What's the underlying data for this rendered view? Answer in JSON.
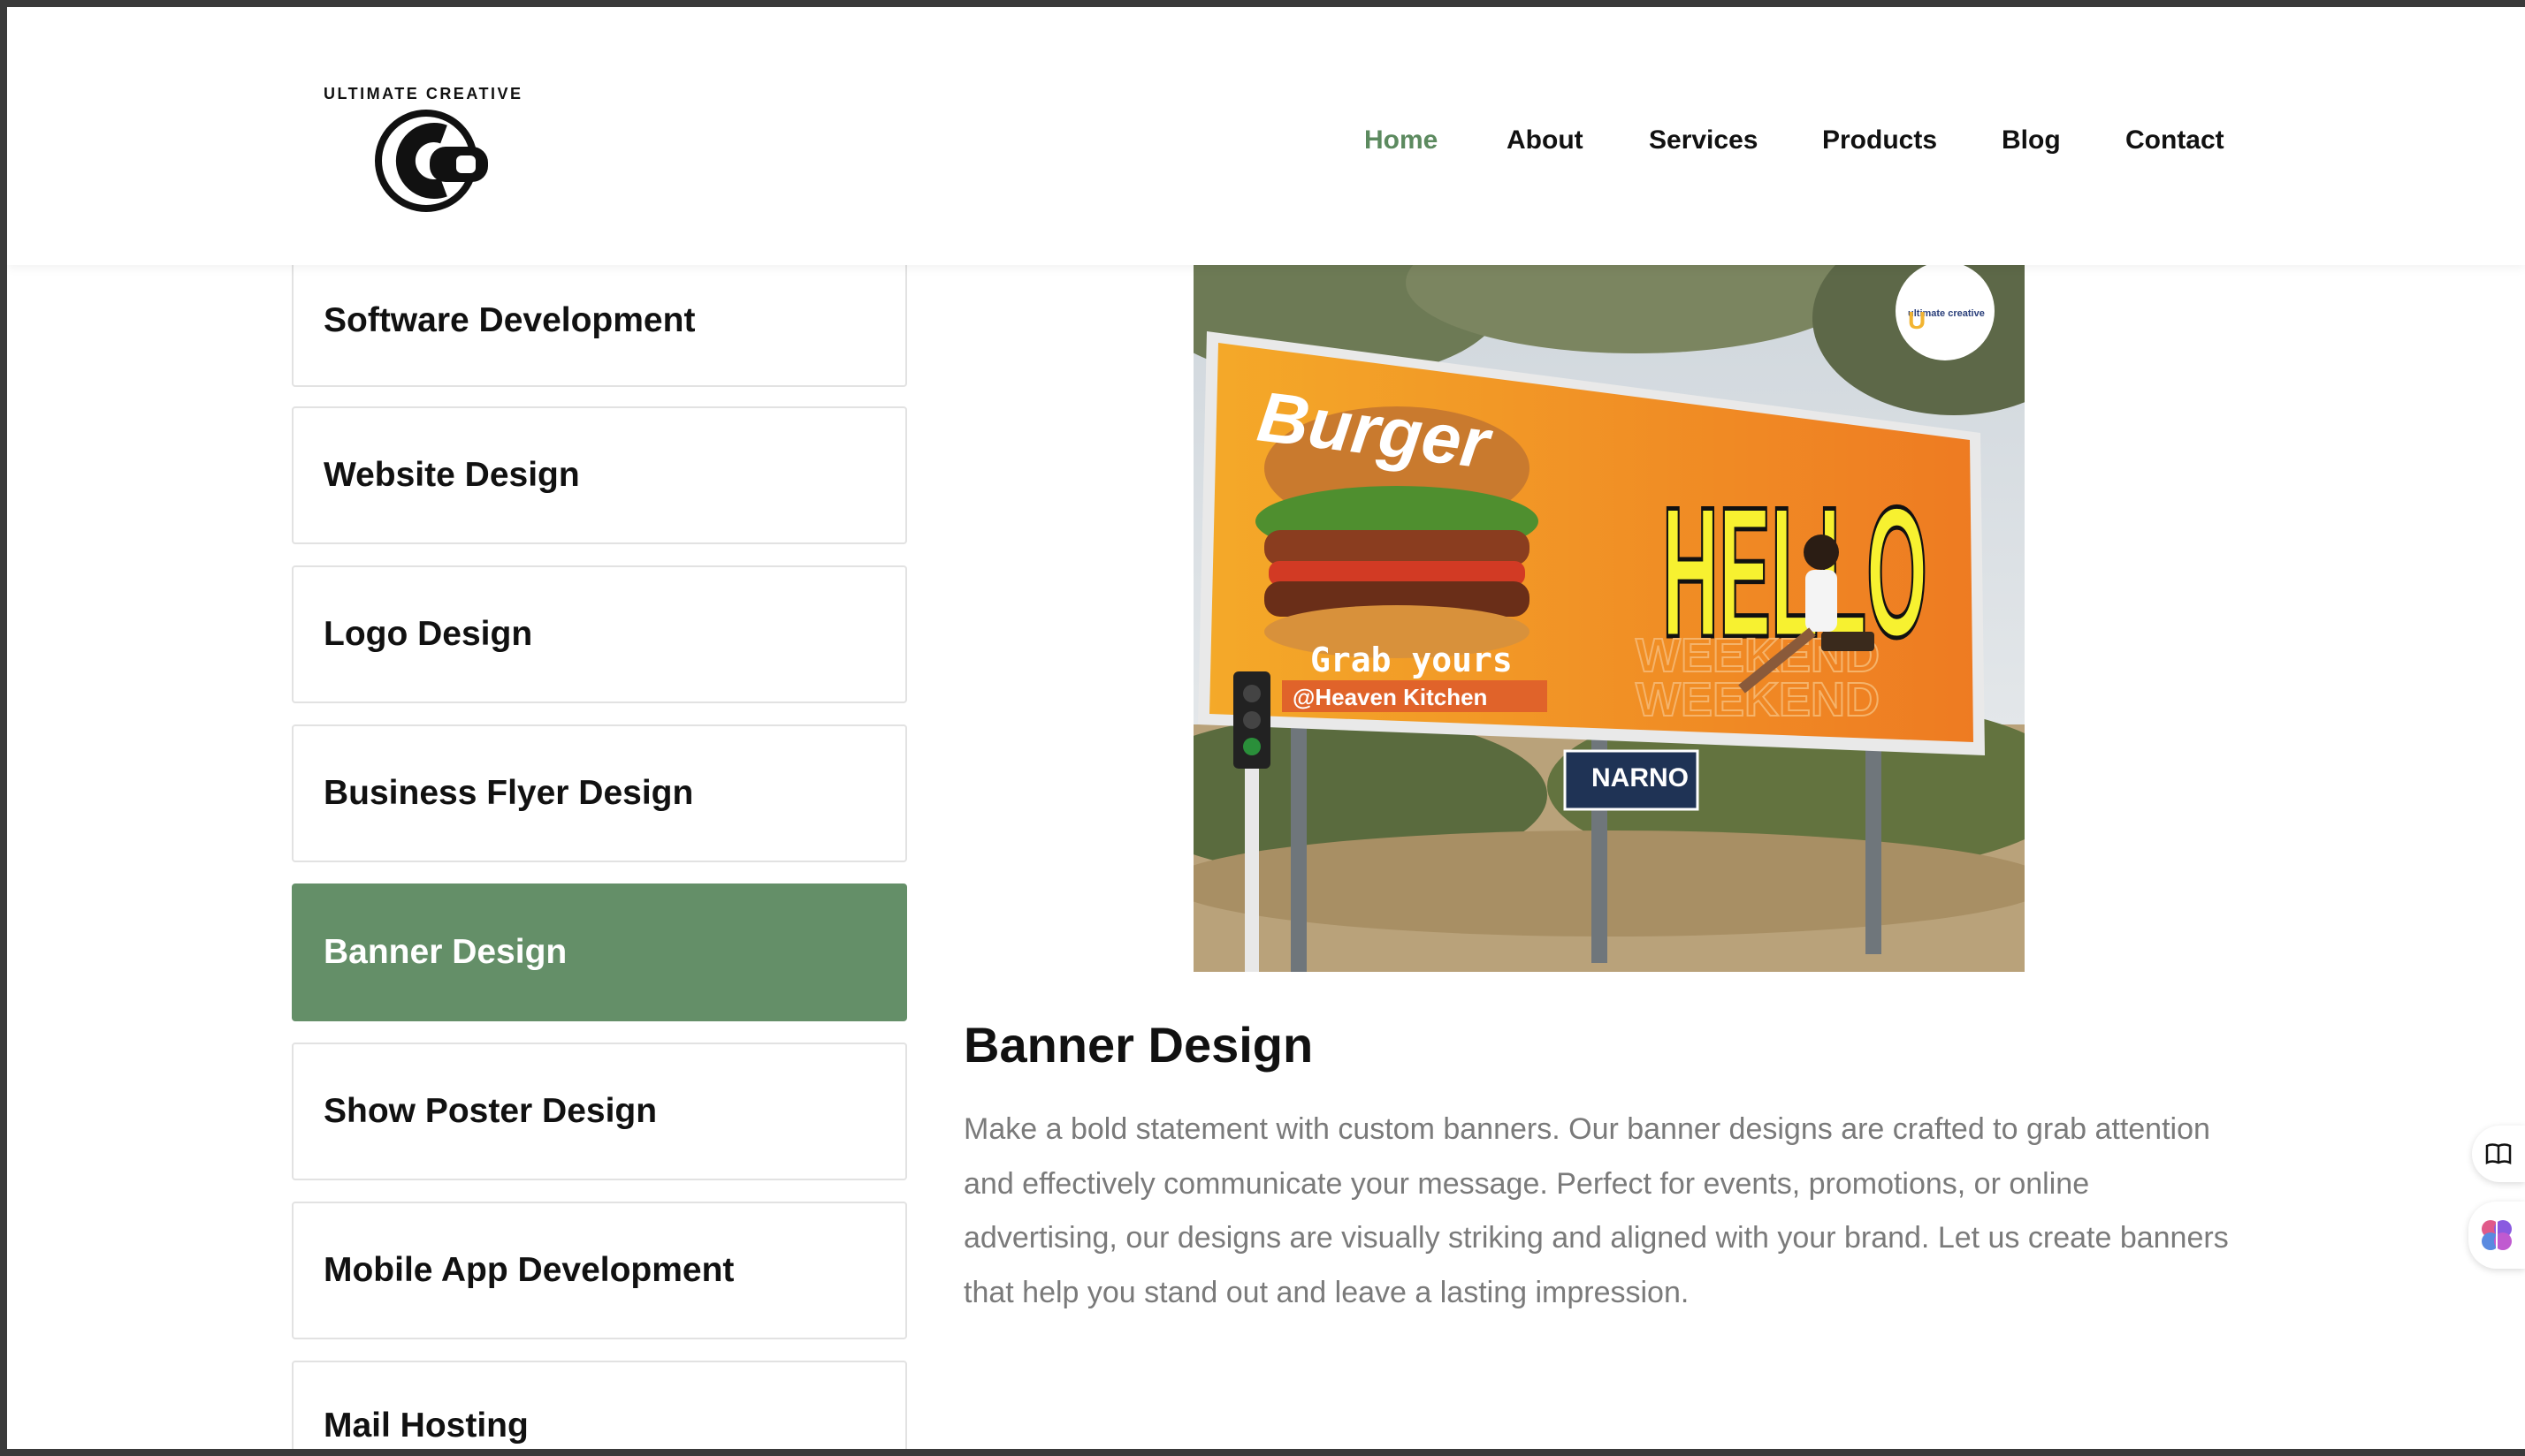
{
  "header": {
    "logo_text": "ULTIMATE CREATIVE",
    "nav": [
      {
        "label": "Home",
        "active": true
      },
      {
        "label": "About"
      },
      {
        "label": "Services"
      },
      {
        "label": "Products"
      },
      {
        "label": "Blog"
      },
      {
        "label": "Contact"
      }
    ]
  },
  "sidebar": {
    "items": [
      {
        "label": "Software Development"
      },
      {
        "label": "Website Design"
      },
      {
        "label": "Logo Design"
      },
      {
        "label": "Business Flyer Design"
      },
      {
        "label": "Banner Design",
        "active": true
      },
      {
        "label": "Show Poster Design"
      },
      {
        "label": "Mobile App Development"
      },
      {
        "label": "Mail Hosting"
      }
    ]
  },
  "banner_image": {
    "word_top": "Burger",
    "headline": "HELLO",
    "grab": "Grab yours",
    "handle": "@Heaven Kitchen",
    "weekend": "WEEKEND",
    "sign": "NARNO",
    "badge": "ultimate creative"
  },
  "main": {
    "title": "Banner Design",
    "description": "Make a bold statement with custom banners. Our banner designs are crafted to grab attention and effectively communicate your message. Perfect for events, promotions, or online advertising, our designs are visually striking and aligned with your brand. Let us create banners that help you stand out and leave a lasting impression."
  },
  "colors": {
    "accent": "#5c8a5f",
    "active_item_bg": "#648f68",
    "text": "#111111",
    "muted_text": "#7a7a7a"
  },
  "floating": {
    "reader_icon": "book-icon",
    "ai_icon": "brain-icon"
  }
}
